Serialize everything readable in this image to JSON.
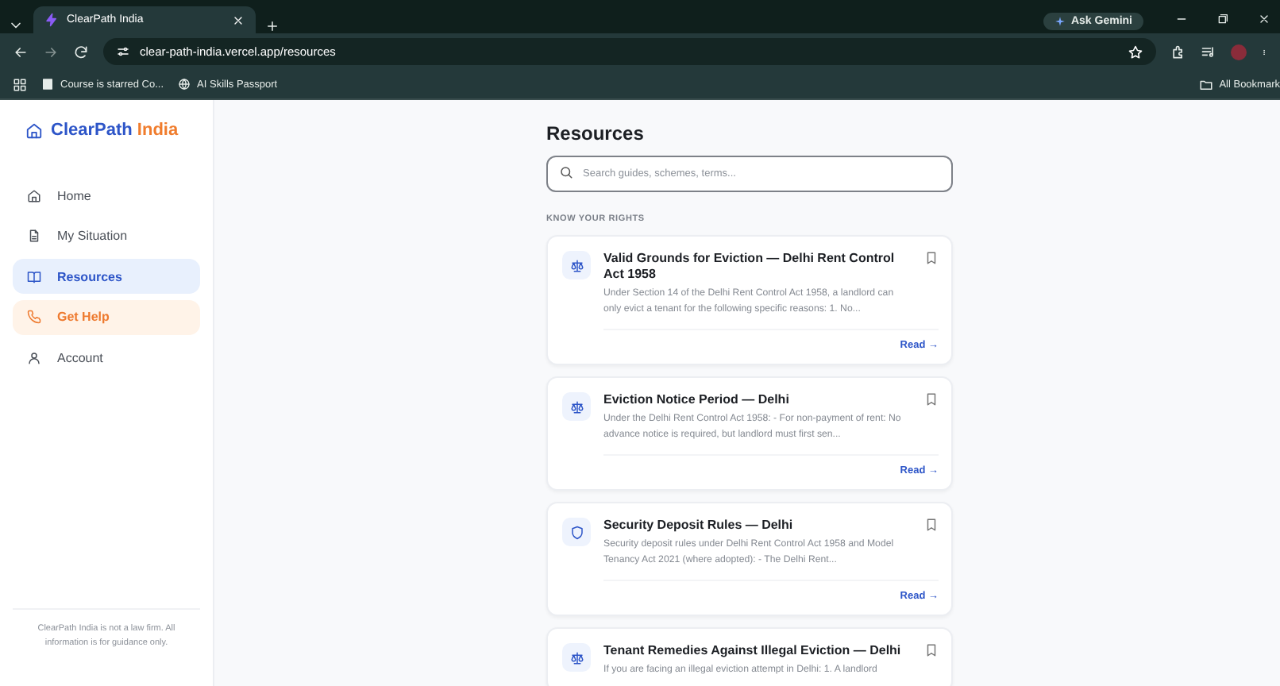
{
  "browser": {
    "tabs": [
      {
        "title": "ClearPath India",
        "selected": true
      }
    ],
    "ask_gemini": "Ask Gemini",
    "url": "clear-path-india.vercel.app/resources",
    "bookmarks": [
      {
        "label": "Course is starred Co...",
        "kind": "page"
      },
      {
        "label": "AI Skills Passport",
        "kind": "globe"
      }
    ],
    "all_bookmarks": "All Bookmark"
  },
  "sidebar": {
    "brand": "ClearPath",
    "brand_accent": "India",
    "items": [
      {
        "label": "Home",
        "kind": "home",
        "selected": false
      },
      {
        "label": "My Situation",
        "kind": "document",
        "selected": false
      },
      {
        "label": "Resources",
        "kind": "book",
        "selected": true
      },
      {
        "label": "Get Help",
        "kind": "phone",
        "selected": false,
        "highlight": true
      },
      {
        "label": "Account",
        "kind": "person",
        "selected": false
      }
    ],
    "footer": "ClearPath India is not a law firm. All information is for guidance only."
  },
  "main": {
    "title": "Resources",
    "search": {
      "placeholder": "Search guides, schemes, terms..."
    },
    "section": "KNOW YOUR RIGHTS",
    "cards": [
      {
        "kind": "scales",
        "title": "Valid Grounds for Eviction — Delhi Rent Control Act 1958",
        "description": "Under Section 14 of the Delhi Rent Control Act 1958, a landlord can only evict a tenant for the following specific reasons: 1. No...",
        "link": "Read →"
      },
      {
        "kind": "scales",
        "title": "Eviction Notice Period — Delhi",
        "description": "Under the Delhi Rent Control Act 1958: - For non-payment of rent: No advance notice is required, but landlord must first sen...",
        "link": "Read →"
      },
      {
        "kind": "shield",
        "title": "Security Deposit Rules — Delhi",
        "description": "Security deposit rules under Delhi Rent Control Act 1958 and Model Tenancy Act 2021 (where adopted): - The Delhi Rent...",
        "link": "Read →"
      },
      {
        "kind": "scales",
        "title": "Tenant Remedies Against Illegal Eviction — Delhi",
        "description": "If you are facing an illegal eviction attempt in Delhi: 1. A landlord"
      }
    ]
  }
}
